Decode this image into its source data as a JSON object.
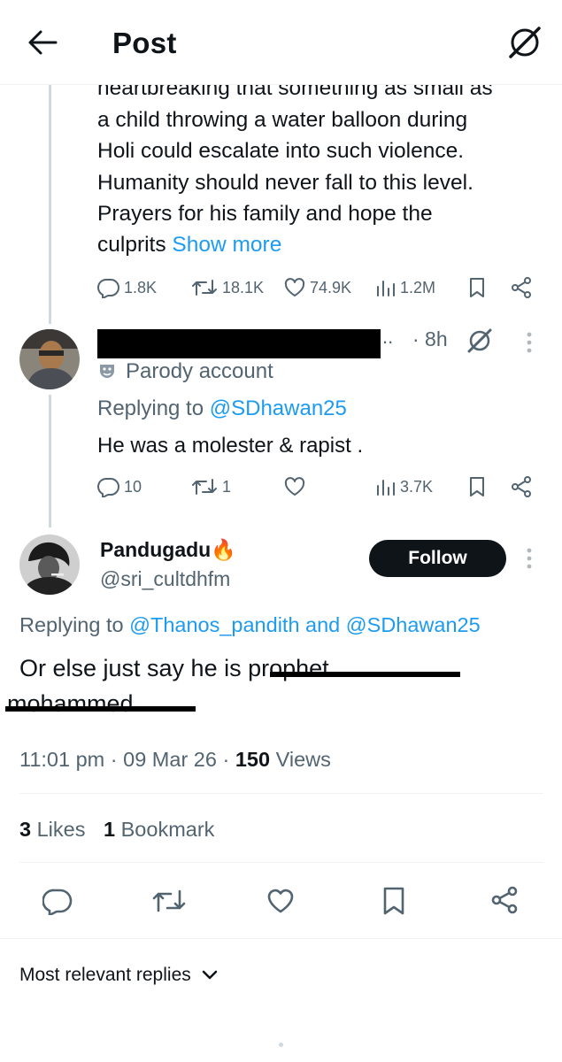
{
  "header": {
    "title": "Post"
  },
  "tweet1": {
    "text_partial": "heartbreaking that something as small as",
    "text_lines": [
      "a child throwing a water balloon during",
      "Holi could escalate into such violence.",
      "Humanity should never fall to this level.",
      "Prayers for his family and hope the"
    ],
    "last_line": "culprits",
    "show_more": "Show more",
    "replies": "1.8K",
    "reposts": "18.1K",
    "likes": "74.9K",
    "views": "1.2M"
  },
  "tweet2": {
    "ellipsis": "..",
    "time": "· 8h",
    "parody_label": "Parody account",
    "replying_prefix": "Replying to",
    "replying_handle": "@SDhawan25",
    "text": "He was a molester & rapist .",
    "replies": "10",
    "reposts": "1",
    "likes": "",
    "views": "3.7K"
  },
  "main": {
    "name": "Pandugadu",
    "name_emoji": "🔥",
    "handle": "@sri_cultdhfm",
    "follow_label": "Follow",
    "replying_prefix": "Replying to",
    "replying_handle1": "@Thanos_pandith",
    "replying_and": "and",
    "replying_handle2": "@SDhawan25",
    "text_visible": "Or else just say he i",
    "text_struck_1": "s prophet",
    "text_struck_2": "mohammed",
    "time": "11:01 pm",
    "date": "09 Mar 26",
    "views_count": "150",
    "views_label": "Views",
    "likes_count": "3",
    "likes_label": "Likes",
    "bookmarks_count": "1",
    "bookmarks_label": "Bookmark"
  },
  "replies_sort": {
    "label": "Most relevant replies"
  },
  "colors": {
    "accent": "#1d9bf0",
    "text": "#0f1419",
    "muted": "#536471",
    "button": "#0f1419"
  }
}
